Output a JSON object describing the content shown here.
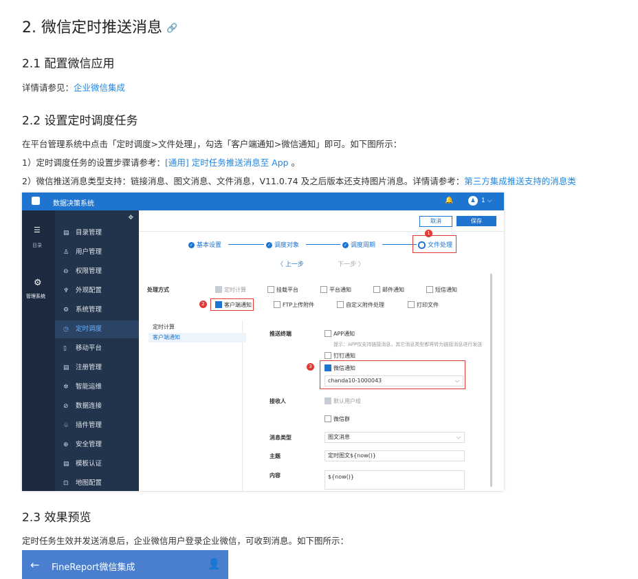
{
  "doc": {
    "h1": "2. 微信定时推送消息",
    "anchor_icon": "link-icon",
    "s21_title": "2.1 配置微信应用",
    "s21_text": "详情请参见：",
    "s21_link": "企业微信集成",
    "s22_title": "2.2 设置定时调度任务",
    "s22_p1": "在平台管理系统中点击「定时调度>文件处理」，勾选「客户端通知>微信通知」即可。如下图所示：",
    "s22_p2_a": "1）定时调度任务的设置步骤请参考：",
    "s22_p2_link": "[通用] 定时任务推送消息至 App",
    "s22_p2_b": " 。",
    "s22_p3_a": "2）微信推送消息类型支持：链接消息、图文消息、文件消息，V11.0.74 及之后版本还支持图片消息。详情请参考：",
    "s22_p3_link": "第三方集成推送支持的消息类",
    "s23_title": "2.3 效果预览",
    "s23_p": "定时任务生效并发送消息后，企业微信用户登录企业微信，可收到消息。如下图所示："
  },
  "screenshot": {
    "app_title": "数据决策系统",
    "user_num": "1",
    "rail": {
      "dir_label": "目录",
      "mgmt_label": "管理系统"
    },
    "nav": [
      {
        "label": "目录管理",
        "icon": "▤"
      },
      {
        "label": "用户管理",
        "icon": "♙"
      },
      {
        "label": "权限管理",
        "icon": "⊖"
      },
      {
        "label": "外观配置",
        "icon": "♆"
      },
      {
        "label": "系统管理",
        "icon": "⚙"
      },
      {
        "label": "定时调度",
        "icon": "◷"
      },
      {
        "label": "移动平台",
        "icon": "▯"
      },
      {
        "label": "注册管理",
        "icon": "▤"
      },
      {
        "label": "智能运维",
        "icon": "✲"
      },
      {
        "label": "数据连接",
        "icon": "⊘"
      },
      {
        "label": "插件管理",
        "icon": "♧"
      },
      {
        "label": "安全管理",
        "icon": "⊕"
      },
      {
        "label": "模板认证",
        "icon": "▤"
      },
      {
        "label": "地图配置",
        "icon": "⊡"
      }
    ],
    "btn_cancel": "取消",
    "btn_save": "保存",
    "steps": [
      "基本设置",
      "调度对象",
      "调度周期",
      "文件处理"
    ],
    "prev": "〈 上一步",
    "next": "下一步 〉",
    "mode_label": "处理方式",
    "modes_row1": [
      "定时计算",
      "挂载平台",
      "平台通知",
      "邮件通知",
      "短信通知"
    ],
    "modes_row2": [
      "客户端通知",
      "FTP上传附件",
      "自定义附件处理",
      "打印文件"
    ],
    "left_items": [
      "定时计算",
      "客户端通知"
    ],
    "push_label": "推送终端",
    "app_notice": "APP通知",
    "app_hint": "提示：APP仅支持链接消息，其它消息类型都将转为链接消息进行发送",
    "dingding": "钉钉通知",
    "wechat": "微信通知",
    "wechat_select": "chanda10-1000043",
    "receiver_label": "接收人",
    "default_group": "默认用户组",
    "wechat_group": "微信群",
    "msg_type_label": "消息类型",
    "msg_type_value": "图文消息",
    "subject_label": "主题",
    "subject_value": "定时图文${now()}",
    "content_label": "内容",
    "content_value": "${now()}",
    "badges": [
      "1",
      "2",
      "3"
    ],
    "accent": "#1f74d0",
    "highlight": "#e53935"
  },
  "phone": {
    "title": "FineReport微信集成"
  }
}
